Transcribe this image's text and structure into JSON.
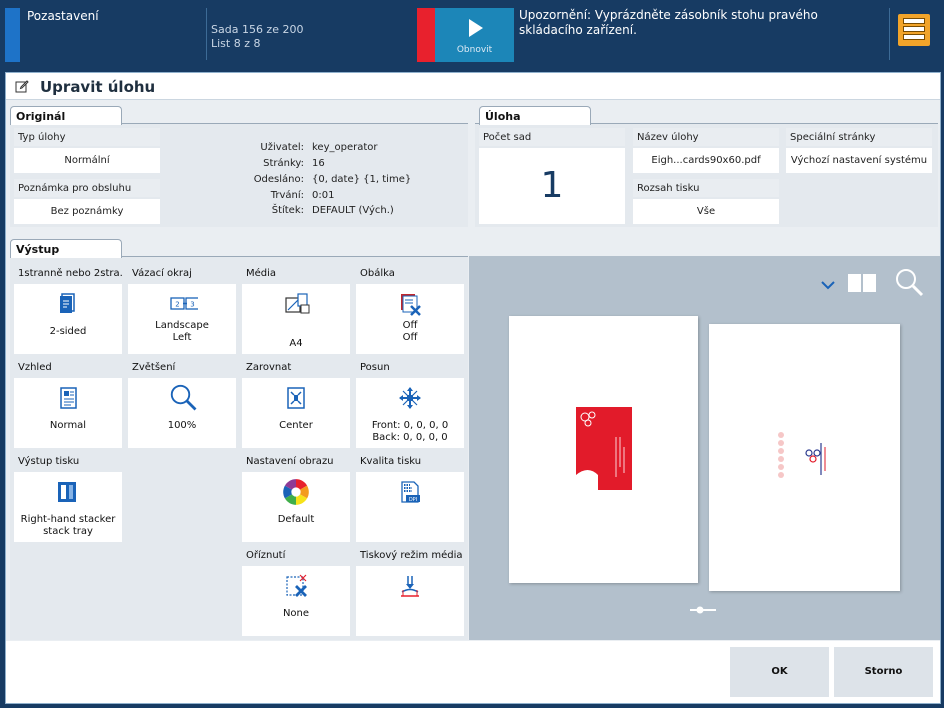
{
  "topbar": {
    "title": "Pozastavení",
    "sada_line1": "Sada 156 ze 200",
    "sada_line2": "List 8 z 8",
    "resume_label": "Obnovit",
    "warning": "Upozornění: Vyprázdněte zásobník stohu pravého skládacího zařízení."
  },
  "window": {
    "title": "Upravit úlohu"
  },
  "original": {
    "tab": "Originál",
    "job_type_label": "Typ úlohy",
    "job_type_value": "Normální",
    "note_label": "Poznámka pro obsluhu",
    "note_value": "Bez poznámky",
    "info": [
      {
        "key": "Uživatel:",
        "value": "key_operator"
      },
      {
        "key": "Stránky:",
        "value": "16"
      },
      {
        "key": "Odesláno:",
        "value": "{0, date} {1, time}"
      },
      {
        "key": "Trvání:",
        "value": "0:01"
      },
      {
        "key": "Štítek:",
        "value": "DEFAULT (Vých.)"
      }
    ]
  },
  "job": {
    "tab": "Úloha",
    "copies_label": "Počet sad",
    "copies_value": "1",
    "name_label": "Název úlohy",
    "name_value": "Eigh...cards90x60.pdf",
    "range_label": "Rozsah tisku",
    "range_value": "Vše",
    "special_label": "Speciální stránky",
    "special_value": "Výchozí nastavení systému"
  },
  "output": {
    "tab": "Výstup",
    "tiles": {
      "sided": {
        "label": "1stranně nebo 2stra...",
        "value": "2-sided",
        "icon": "duplex-icon"
      },
      "binding": {
        "label": "Vázací okraj",
        "value1": "Landscape",
        "value2": "Left",
        "icon": "binding-edge-icon"
      },
      "media": {
        "label": "Média",
        "value": "A4",
        "icon": "media-icon"
      },
      "cover": {
        "label": "Obálka",
        "value1": "Off",
        "value2": "Off",
        "icon": "cover-icon"
      },
      "layout": {
        "label": "Vzhled",
        "value": "Normal",
        "icon": "layout-icon"
      },
      "zoom": {
        "label": "Zvětšení",
        "value": "100%",
        "icon": "magnifier-icon"
      },
      "align": {
        "label": "Zarovnat",
        "value": "Center",
        "icon": "align-center-icon"
      },
      "shift": {
        "label": "Posun",
        "value1": "Front: 0, 0, 0, 0",
        "value2": "Back: 0, 0, 0, 0",
        "icon": "shift-icon"
      },
      "output_tray": {
        "label": "Výstup tisku",
        "value1": "Right-hand stacker",
        "value2": "stack tray",
        "icon": "stacker-icon"
      },
      "image_settings": {
        "label": "Nastavení obrazu",
        "value": "Default",
        "icon": "color-wheel-icon"
      },
      "quality": {
        "label": "Kvalita tisku",
        "value": "",
        "icon": "print-quality-icon"
      },
      "trim": {
        "label": "Oříznutí",
        "value": "None",
        "icon": "trim-icon"
      },
      "media_mode": {
        "label": "Tiskový režim média",
        "value": "",
        "icon": "media-mode-icon"
      }
    }
  },
  "buttons": {
    "ok": "OK",
    "cancel": "Storno"
  },
  "colors": {
    "accent": "#1e73c8",
    "topbar": "#173b63",
    "alert": "#e8212d",
    "icon_blue": "#1a63b8",
    "card_red": "#e21b2a"
  }
}
